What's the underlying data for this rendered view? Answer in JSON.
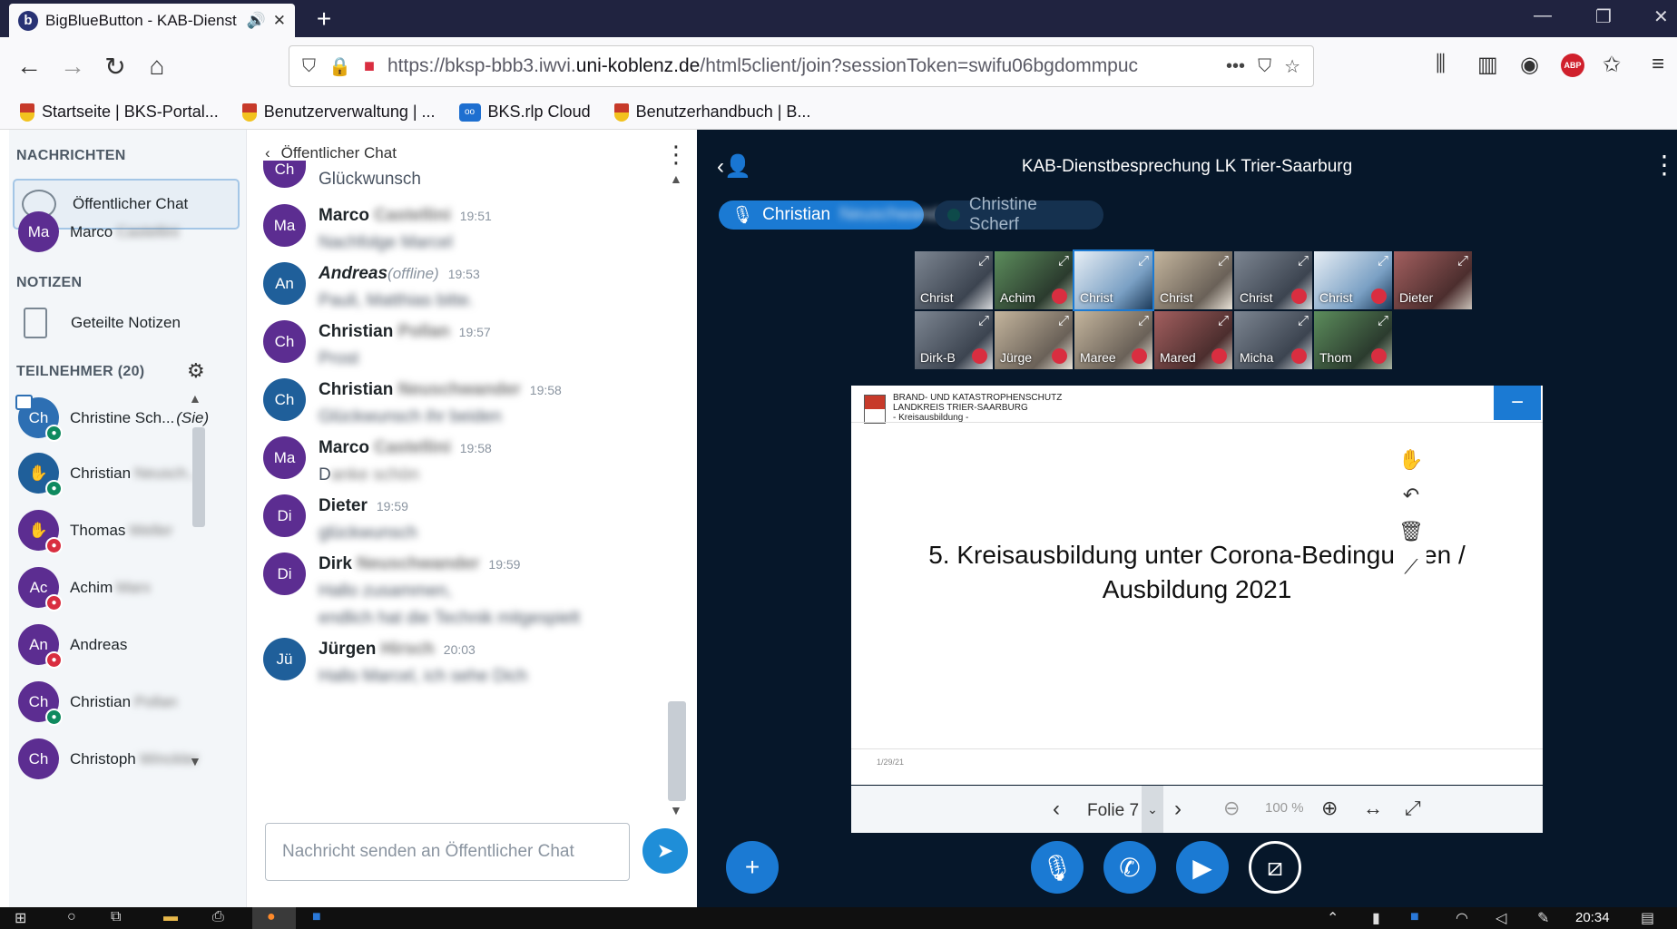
{
  "browser": {
    "tab_title": "BigBlueButton - KAB-Dienst",
    "url_prefix": "https://bksp-bbb3.iwvi.",
    "url_domain": "uni-koblenz.de",
    "url_path": "/html5client/join?sessionToken=swifu06bgdommpuc",
    "bookmarks": [
      {
        "label": "Startseite | BKS-Portal..."
      },
      {
        "label": "Benutzerverwaltung | ..."
      },
      {
        "label": "BKS.rlp Cloud"
      },
      {
        "label": "Benutzerhandbuch | B..."
      }
    ]
  },
  "sidebar": {
    "messages_title": "NACHRICHTEN",
    "public_chat": "Öffentlicher Chat",
    "private_chat": {
      "initials": "Ma",
      "name": "Marco",
      "surname": "Castellini"
    },
    "notes_title": "NOTIZEN",
    "shared_notes": "Geteilte Notizen",
    "participants_title": "TEILNEHMER (20)",
    "participants": [
      {
        "initials": "Ch",
        "name": "Christine Sch...",
        "suffix": "(Sie)",
        "status": "mic-on",
        "color": "lblue"
      },
      {
        "initials": "✋",
        "name": "Christian",
        "surname": "Neusch...",
        "status": "mic-on",
        "color": "blue"
      },
      {
        "initials": "✋",
        "name": "Thomas",
        "surname": "Weller",
        "status": "muted",
        "color": "purple"
      },
      {
        "initials": "Ac",
        "name": "Achim",
        "surname": "Marx",
        "status": "muted",
        "color": "purple"
      },
      {
        "initials": "An",
        "name": "Andreas",
        "surname": "",
        "status": "muted",
        "color": "purple"
      },
      {
        "initials": "Ch",
        "name": "Christian",
        "surname": "Pollan",
        "status": "mic-on",
        "color": "purple"
      },
      {
        "initials": "Ch",
        "name": "Christoph",
        "surname": "Winckler",
        "status": "none",
        "color": "purple"
      }
    ]
  },
  "chat": {
    "header": "Öffentlicher Chat",
    "top_partial": {
      "initials": "Ch",
      "text": "Glückwunsch"
    },
    "messages": [
      {
        "initials": "Ma",
        "name": "Marco",
        "surname": "Castellini",
        "time": "19:51",
        "text": "Nachfolge Marcel",
        "color": "purple"
      },
      {
        "initials": "An",
        "name": "Andreas",
        "surname": "",
        "offline": "(offline)",
        "time": "19:53",
        "text": "Pauli, Matthias bitte.",
        "color": "blue"
      },
      {
        "initials": "Ch",
        "name": "Christian",
        "surname": "Pollan",
        "time": "19:57",
        "text": "Prost",
        "color": "purple"
      },
      {
        "initials": "Ch",
        "name": "Christian",
        "surname": "Neuschwander",
        "time": "19:58",
        "text": "Glückwunsch ihr beiden",
        "color": "blue"
      },
      {
        "initials": "Ma",
        "name": "Marco",
        "surname": "Castellini",
        "time": "19:58",
        "text": "D",
        "text_blur": "anke schön",
        "color": "purple"
      },
      {
        "initials": "Di",
        "name": "Dieter",
        "surname": "",
        "time": "19:59",
        "text": "glückwunsch",
        "color": "purple"
      },
      {
        "initials": "Di",
        "name": "Dirk",
        "surname": "Neuschwander",
        "time": "19:59",
        "text": "Hallo zusammen,",
        "text2": "endlich hat die Technik mitgespielt",
        "color": "purple"
      },
      {
        "initials": "Jü",
        "name": "Jürgen",
        "surname": "Hirsch",
        "time": "20:03",
        "text": "Hallo Marcel, ich sehe Dich",
        "color": "blue"
      }
    ],
    "input_placeholder": "Nachricht senden an Öffentlicher Chat"
  },
  "meeting": {
    "title": "KAB-Dienstbesprechung LK Trier-Saarburg",
    "talkers": [
      {
        "name": "Christian",
        "surname": "Neuschwander"
      },
      {
        "name": "Christine Scherf"
      }
    ],
    "cams": [
      {
        "name": "Christ",
        "muted": false
      },
      {
        "name": "Achim",
        "muted": true
      },
      {
        "name": "Christ",
        "muted": false
      },
      {
        "name": "Christ",
        "muted": false
      },
      {
        "name": "Christ",
        "muted": true
      },
      {
        "name": "Christ",
        "muted": true
      },
      {
        "name": "Dieter",
        "muted": false
      },
      {
        "name": "Dirk-B",
        "muted": true
      },
      {
        "name": "Jürge",
        "muted": true
      },
      {
        "name": "Maree",
        "muted": true
      },
      {
        "name": "Mared",
        "muted": true
      },
      {
        "name": "Micha",
        "muted": true
      },
      {
        "name": "Thom",
        "muted": true
      }
    ],
    "slide": {
      "org_line1": "BRAND- UND KATASTROPHENSCHUTZ",
      "org_line2": "LANDKREIS TRIER-SAARBURG",
      "org_line3": "- Kreisausbildung -",
      "title_line1": "5. Kreisausbildung unter Corona-Bedingungen /",
      "title_line2": "Ausbildung 2021",
      "date": "1/29/21"
    },
    "slide_label": "Folie 7",
    "zoom": "100 %"
  },
  "taskbar": {
    "clock": "20:34"
  },
  "colors": {
    "accent": "#1b7ad3",
    "stage_bg": "#06172a",
    "avatar_purple": "#5c2d91",
    "avatar_blue": "#1f5f9a",
    "muted_red": "#d92e40",
    "mic_green": "#0f8a5f"
  }
}
